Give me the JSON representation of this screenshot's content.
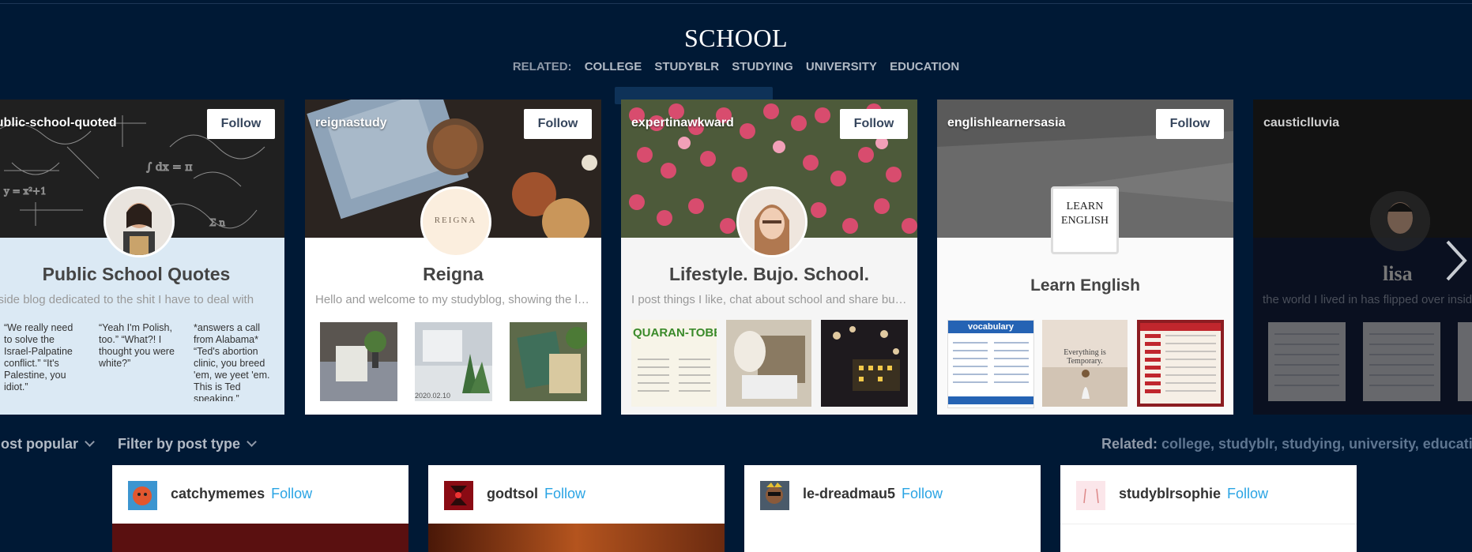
{
  "page": {
    "title": "SCHOOL"
  },
  "related_top": {
    "label": "RELATED:",
    "tags": [
      "COLLEGE",
      "STUDYBLR",
      "STUDYING",
      "UNIVERSITY",
      "EDUCATION"
    ]
  },
  "blog_cards": [
    {
      "name": "public-school-quoted",
      "follow": "Follow",
      "title": "Public School Quotes",
      "description": "a side blog dedicated to the shit I have to deal with",
      "quotes": [
        "“We really need to solve the Israel-Palpatine conflict.” “It's Palestine, you idiot.”",
        "“Yeah I'm Polish, too.” “What?! I thought you were white?”",
        "*answers a call from Alabama* “Ted's abortion clinic, you breed 'em, we yeet 'em. This is Ted speaking.”"
      ]
    },
    {
      "name": "reignastudy",
      "follow": "Follow",
      "title": "Reigna",
      "description": "Hello and welcome to my studyblog, showing the life of",
      "logo_text": "REIGNA",
      "thumb_caption": "2020.02.10"
    },
    {
      "name": "expertinawkward",
      "follow": "Follow",
      "title": "Lifestyle. Bujo. School.",
      "description": "I post things I like, chat about school and share bullet journal",
      "thumb_text": "QUARAN-TOBER"
    },
    {
      "name": "englishlearnersasia",
      "follow": "Follow",
      "title": "Learn English",
      "logo_text": [
        "LEARN",
        "ENGLISH"
      ],
      "thumb_heading": "vocabulary",
      "thumb_caption": "Everything is Temporary."
    },
    {
      "name": "causticlluvia",
      "title": "lisa",
      "description": "the world I lived in has flipped over inside"
    }
  ],
  "filter_bar": {
    "sort": "Most popular",
    "filter": "Filter by post type",
    "related_label": "Related:",
    "related_values": "college, studyblr, studying, university, education"
  },
  "posts": [
    {
      "name": "catchymemes",
      "follow": "Follow"
    },
    {
      "name": "godtsol",
      "follow": "Follow"
    },
    {
      "name": "le-dreadmau5",
      "follow": "Follow"
    },
    {
      "name": "studyblrsophie",
      "follow": "Follow"
    }
  ],
  "icons": {
    "next": "chevron-right-icon",
    "dropdown": "chevron-down-icon"
  },
  "colors": {
    "background": "#001935",
    "follow_link": "#2aa4e4",
    "muted": "#b2bac5"
  }
}
